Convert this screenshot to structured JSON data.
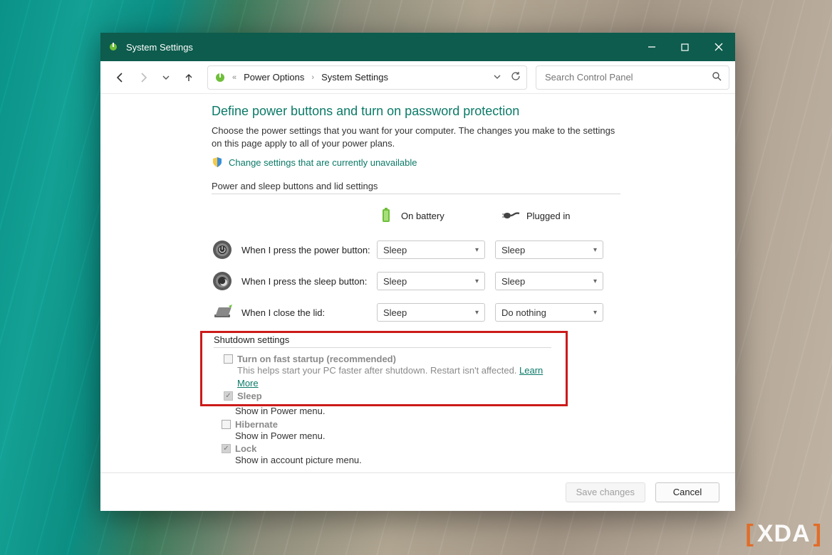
{
  "titlebar": {
    "title": "System Settings"
  },
  "breadcrumb": {
    "item1": "Power Options",
    "item2": "System Settings"
  },
  "search": {
    "placeholder": "Search Control Panel"
  },
  "heading": "Define power buttons and turn on password protection",
  "intro": "Choose the power settings that you want for your computer. The changes you make to the settings on this page apply to all of your power plans.",
  "change_link": "Change settings that are currently unavailable",
  "section1_title": "Power and sleep buttons and lid settings",
  "columns": {
    "battery": "On battery",
    "plugged": "Plugged in"
  },
  "rows": {
    "power": {
      "label": "When I press the power button:",
      "battery": "Sleep",
      "plugged": "Sleep"
    },
    "sleep": {
      "label": "When I press the sleep button:",
      "battery": "Sleep",
      "plugged": "Sleep"
    },
    "lid": {
      "label": "When I close the lid:",
      "battery": "Sleep",
      "plugged": "Do nothing"
    }
  },
  "shutdown": {
    "title": "Shutdown settings",
    "fast_startup": {
      "label": "Turn on fast startup (recommended)",
      "desc_prefix": "This helps start your PC faster after shutdown. Restart isn't affected. ",
      "learn_more": "Learn More"
    },
    "sleep": {
      "label": "Sleep",
      "desc": "Show in Power menu."
    },
    "hibernate": {
      "label": "Hibernate",
      "desc": "Show in Power menu."
    },
    "lock": {
      "label": "Lock",
      "desc": "Show in account picture menu."
    }
  },
  "footer": {
    "save": "Save changes",
    "cancel": "Cancel"
  },
  "watermark": {
    "text": "XDA"
  }
}
